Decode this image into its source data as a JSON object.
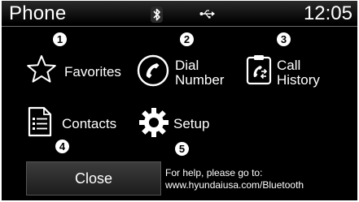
{
  "statusbar": {
    "title": "Phone",
    "time": "12:05",
    "icons": [
      "bluetooth-icon",
      "usb-icon"
    ]
  },
  "menu": {
    "favorites": {
      "badge": "1",
      "label": "Favorites",
      "icon": "star-icon"
    },
    "dial_number": {
      "badge": "2",
      "label_line1": "Dial",
      "label_line2": "Number",
      "icon": "handset-icon"
    },
    "call_history": {
      "badge": "3",
      "label_line1": "Call",
      "label_line2": "History",
      "icon": "call-history-icon"
    },
    "contacts": {
      "badge": "4",
      "label": "Contacts",
      "icon": "document-icon"
    },
    "setup": {
      "badge": "5",
      "label": "Setup",
      "icon": "gear-icon"
    }
  },
  "footer": {
    "close_label": "Close",
    "help_line1": "For help, please go to:",
    "help_line2": "www.hyundaiusa.com/Bluetooth"
  }
}
